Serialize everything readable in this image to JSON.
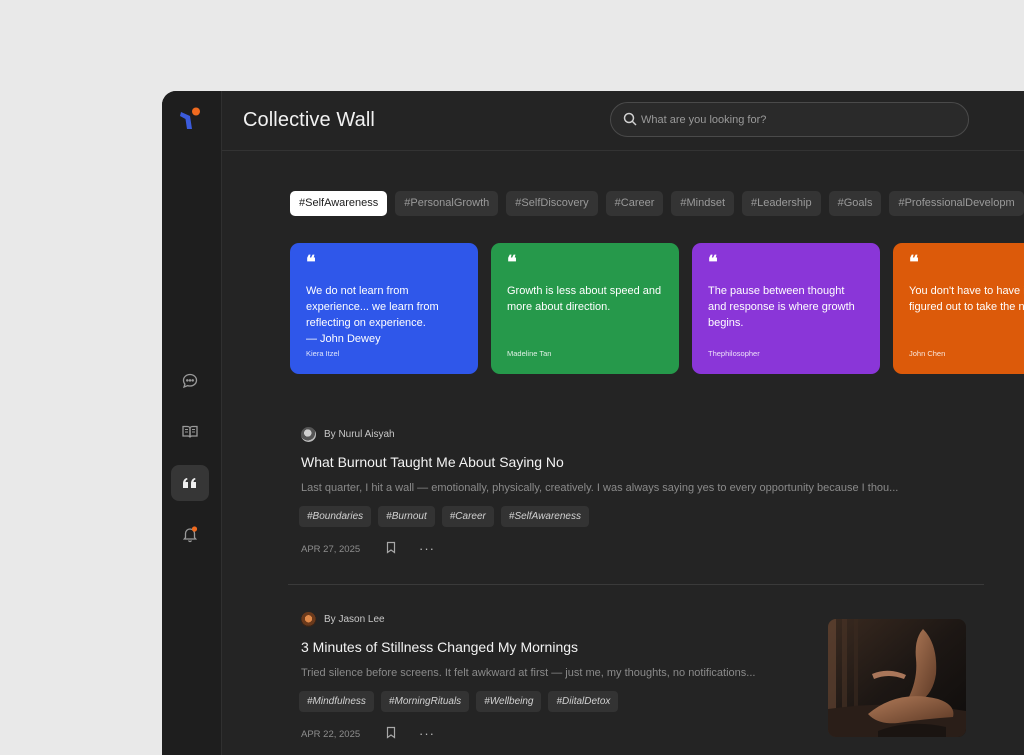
{
  "app": {
    "title": "Collective Wall"
  },
  "search": {
    "placeholder": "What are you looking for?"
  },
  "sidebar": {
    "items": [
      {
        "name": "messages",
        "icon": "chat-bubble-icon"
      },
      {
        "name": "library",
        "icon": "open-book-icon"
      },
      {
        "name": "quotes",
        "icon": "quote-icon",
        "active": true
      },
      {
        "name": "notifications",
        "icon": "bell-icon",
        "badge": true
      }
    ]
  },
  "tags": [
    "#SelfAwareness",
    "#PersonalGrowth",
    "#SelfDiscovery",
    "#Career",
    "#Mindset",
    "#Leadership",
    "#Goals",
    "#ProfessionalDevelopm"
  ],
  "quotes": [
    {
      "text": "We do not learn from experience... we learn from reflecting on experience.\n— John Dewey",
      "author": "Kiera Itzel",
      "color": "#2f57ea"
    },
    {
      "text": "Growth is less about speed and more about direction.",
      "author": "Madeline Tan",
      "color": "#26994b"
    },
    {
      "text": "The pause between thought and response is where growth begins.",
      "author": "Thephilosopher",
      "color": "#8a36d8"
    },
    {
      "text": "You don't have to have it figured out to take the n step.",
      "author": "John Chen",
      "color": "#dc5a0a"
    }
  ],
  "articles": [
    {
      "byline": "By Nurul Aisyah",
      "title": "What Burnout Taught Me About Saying No",
      "excerpt": "Last quarter, I hit a wall — emotionally, physically, creatively. I was always saying yes to every opportunity because I thou...",
      "tags": [
        "#Boundaries",
        "#Burnout",
        "#Career",
        "#SelfAwareness"
      ],
      "date": "APR 27, 2025",
      "more": "···"
    },
    {
      "byline": "By Jason Lee",
      "title": "3 Minutes of Stillness Changed My Mornings",
      "excerpt": "Tried silence before screens. It felt awkward at first — just me, my thoughts, no notifications...",
      "tags": [
        "#Mindfulness",
        "#MorningRituals",
        "#Wellbeing",
        "#DiitalDetox"
      ],
      "date": "APR 22, 2025",
      "more": "···"
    }
  ],
  "colors": {
    "accent_orange": "#ef6a1f",
    "logo_blue": "#3b5bdb"
  }
}
